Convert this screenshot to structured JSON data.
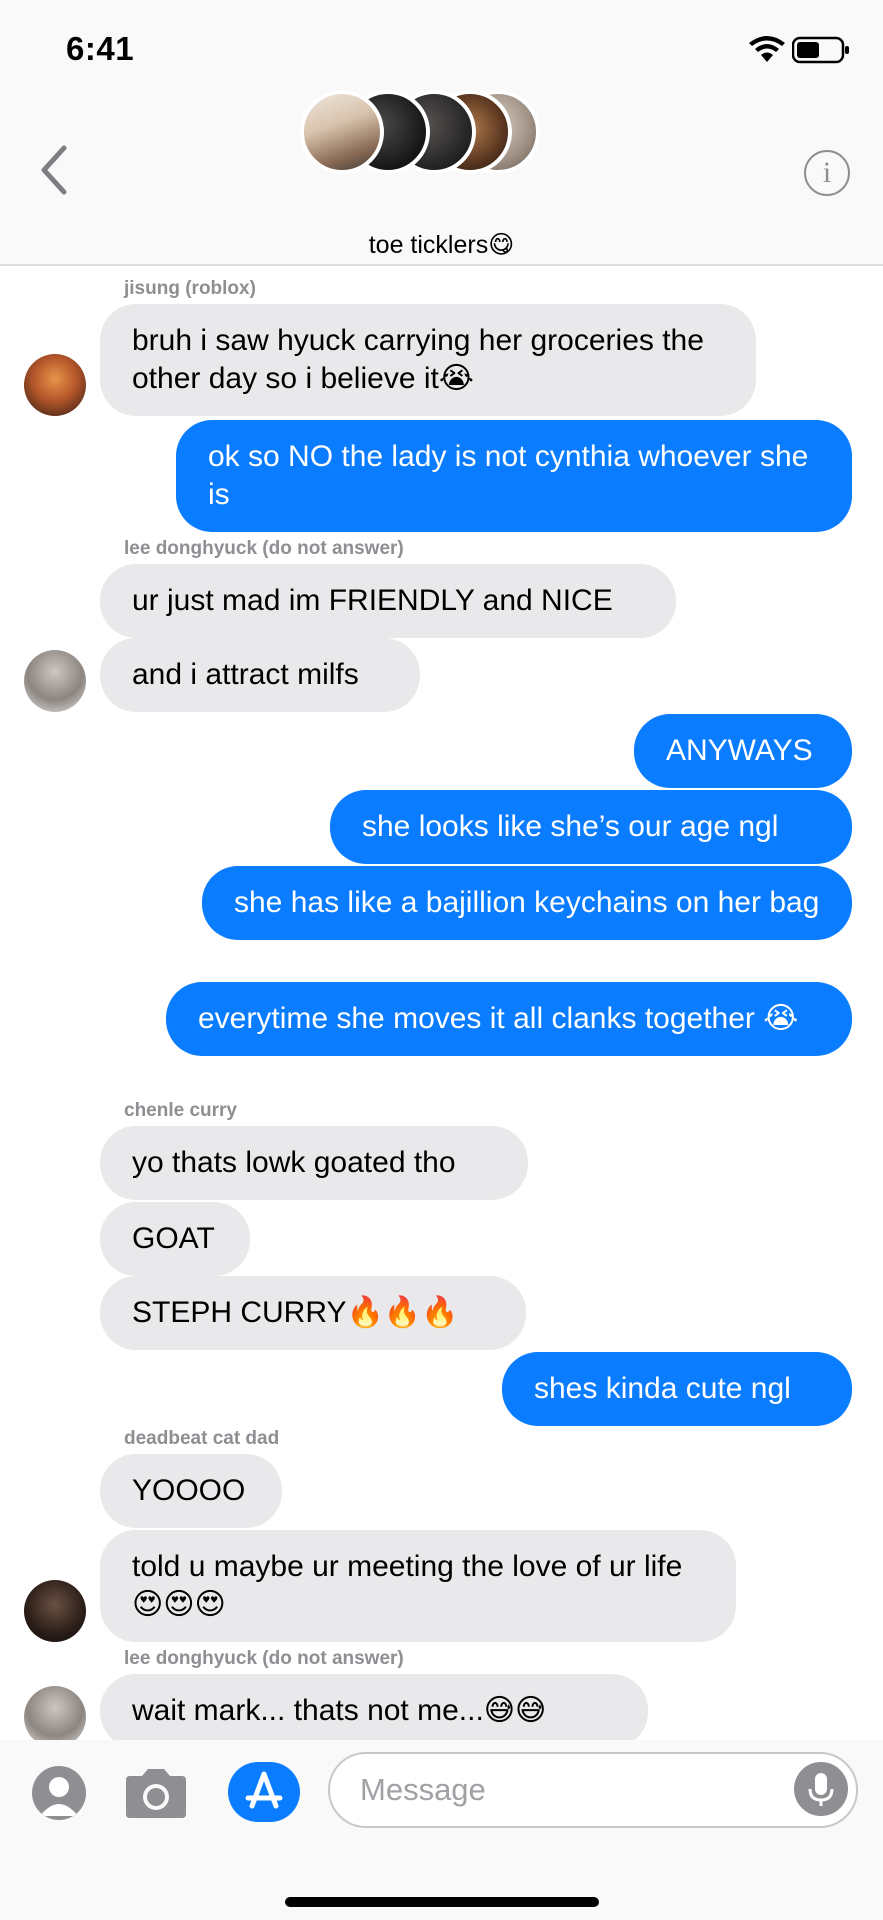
{
  "status_bar": {
    "time": "6:41"
  },
  "header": {
    "group_name": "toe ticklers",
    "title_emoji": "😋",
    "info_glyph": "i"
  },
  "messages": [
    {
      "sender": "jisung (roblox)"
    },
    {
      "text": "bruh i saw hyuck carrying her groceries the other day so i believe it😭"
    },
    {
      "text": "ok so NO the lady is not cynthia whoever she is"
    },
    {
      "sender": "lee donghyuck (do not answer)"
    },
    {
      "text": "ur just mad im FRIENDLY and NICE"
    },
    {
      "text": "and i attract milfs"
    },
    {
      "text": "ANYWAYS"
    },
    {
      "text": "she looks like she’s our age ngl"
    },
    {
      "text": "she has like a bajillion keychains on her bag"
    },
    {
      "text": "everytime she moves it all clanks together 😭"
    },
    {
      "sender": "chenle curry"
    },
    {
      "text": "yo thats lowk goated tho"
    },
    {
      "text": "GOAT"
    },
    {
      "text": "STEPH CURRY🔥🔥🔥"
    },
    {
      "text": "shes kinda cute ngl"
    },
    {
      "sender": "deadbeat cat dad"
    },
    {
      "text": "YOOOO"
    },
    {
      "text": "told u maybe ur meeting the love of ur life😍😍😍"
    },
    {
      "sender": "lee donghyuck (do not answer)"
    },
    {
      "text": "wait mark... thats not me...😅😅"
    }
  ],
  "input": {
    "placeholder": "Message"
  },
  "colors": {
    "sent": "#0a7cff",
    "received": "#e9e9eb",
    "secondary_text": "#8e8e93"
  },
  "icons": [
    "wifi-icon",
    "battery-icon",
    "chevron-left-icon",
    "info-icon",
    "contact-icon",
    "camera-icon",
    "app-store-icon",
    "microphone-icon"
  ]
}
